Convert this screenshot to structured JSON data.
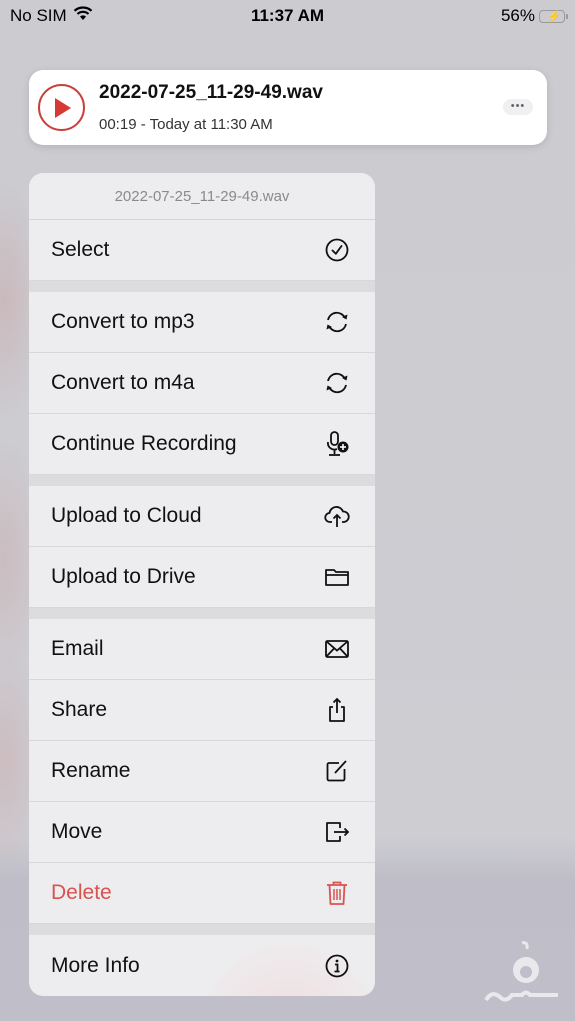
{
  "status_bar": {
    "carrier": "No SIM",
    "time": "11:37 AM",
    "battery_percent_label": "56%",
    "battery_level": 0.56,
    "battery_charging": true
  },
  "recording": {
    "title": "2022-07-25_11-29-49.wav",
    "subtitle": "00:19 - Today at 11:30 AM",
    "more_label": "•••"
  },
  "menu": {
    "header": "2022-07-25_11-29-49.wav",
    "groups": [
      [
        {
          "label": "Select",
          "icon": "checkmark-circle-icon"
        }
      ],
      [
        {
          "label": "Convert to mp3",
          "icon": "convert-icon"
        },
        {
          "label": "Convert to m4a",
          "icon": "convert-icon"
        },
        {
          "label": "Continue Recording",
          "icon": "mic-plus-icon"
        }
      ],
      [
        {
          "label": "Upload to Cloud",
          "icon": "cloud-upload-icon"
        },
        {
          "label": "Upload to Drive",
          "icon": "folder-icon"
        }
      ],
      [
        {
          "label": "Email",
          "icon": "envelope-icon"
        },
        {
          "label": "Share",
          "icon": "share-icon"
        },
        {
          "label": "Rename",
          "icon": "edit-icon"
        },
        {
          "label": "Move",
          "icon": "move-icon"
        },
        {
          "label": "Delete",
          "icon": "trash-icon",
          "destructive": true
        }
      ],
      [
        {
          "label": "More Info",
          "icon": "info-icon"
        }
      ]
    ]
  },
  "colors": {
    "accent_red": "#d9534f",
    "play_red": "#c9413c",
    "battery_green": "#4cd964"
  }
}
